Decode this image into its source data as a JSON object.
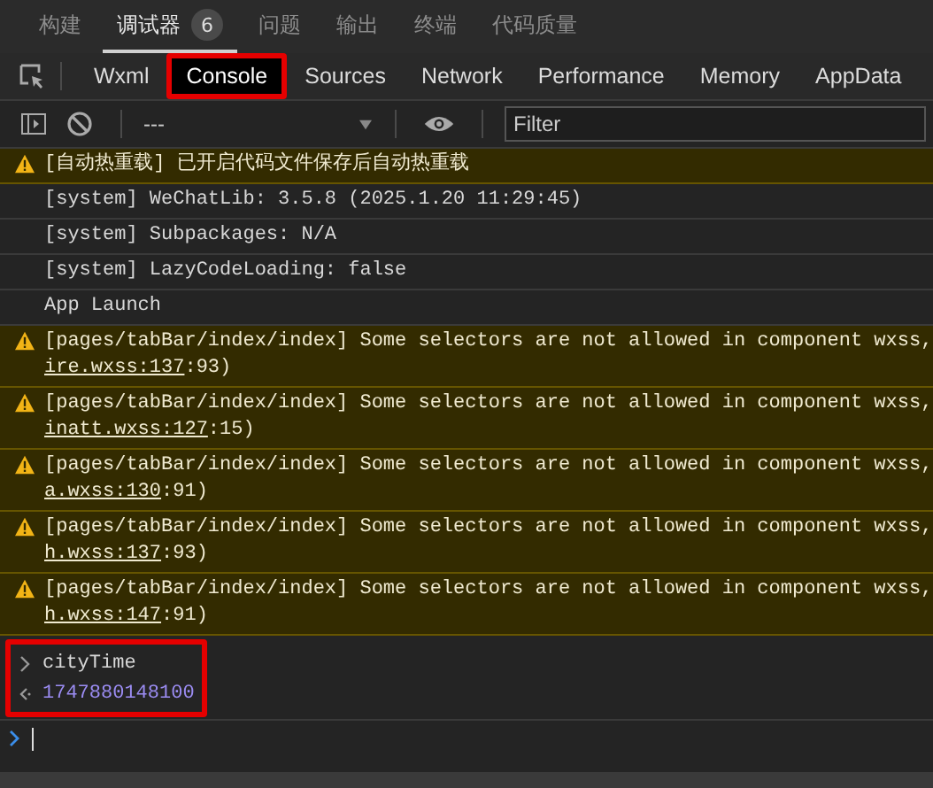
{
  "top_tabs": [
    {
      "label": "构建",
      "selected": false
    },
    {
      "label": "调试器",
      "selected": true,
      "badge": "6"
    },
    {
      "label": "问题",
      "selected": false
    },
    {
      "label": "输出",
      "selected": false
    },
    {
      "label": "终端",
      "selected": false
    },
    {
      "label": "代码质量",
      "selected": false
    }
  ],
  "devtools_tabs": [
    {
      "label": "Wxml",
      "selected": false,
      "highlighted": false
    },
    {
      "label": "Console",
      "selected": true,
      "highlighted": true
    },
    {
      "label": "Sources",
      "selected": false,
      "highlighted": false
    },
    {
      "label": "Network",
      "selected": false,
      "highlighted": false
    },
    {
      "label": "Performance",
      "selected": false,
      "highlighted": false
    },
    {
      "label": "Memory",
      "selected": false,
      "highlighted": false
    },
    {
      "label": "AppData",
      "selected": false,
      "highlighted": false
    }
  ],
  "toolbar": {
    "context": "---",
    "filter_placeholder": "Filter"
  },
  "console": {
    "entries": [
      {
        "kind": "warning",
        "text": "[自动热重载] 已开启代码文件保存后自动热重载"
      },
      {
        "kind": "log",
        "text": "[system] WeChatLib: 3.5.8 (2025.1.20 11:29:45)"
      },
      {
        "kind": "log",
        "text": "[system] Subpackages: N/A"
      },
      {
        "kind": "log",
        "text": "[system] LazyCodeLoading: false"
      },
      {
        "kind": "log",
        "text": "App Launch"
      },
      {
        "kind": "warning",
        "text": "[pages/tabBar/index/index] Some selectors are not allowed in component wxss,",
        "link": "ire.wxss:137",
        "tail": ":93)"
      },
      {
        "kind": "warning",
        "text": "[pages/tabBar/index/index] Some selectors are not allowed in component wxss,",
        "link": "inatt.wxss:127",
        "tail": ":15)"
      },
      {
        "kind": "warning",
        "text": "[pages/tabBar/index/index] Some selectors are not allowed in component wxss,",
        "link": "a.wxss:130",
        "tail": ":91)"
      },
      {
        "kind": "warning",
        "text": "[pages/tabBar/index/index] Some selectors are not allowed in component wxss,",
        "link": "h.wxss:137",
        "tail": ":93)"
      },
      {
        "kind": "warning",
        "text": "[pages/tabBar/index/index] Some selectors are not allowed in component wxss,",
        "link": "h.wxss:147",
        "tail": ":91)"
      }
    ],
    "evaluation": {
      "highlighted": true,
      "input": "cityTime",
      "result": "1747880148100"
    }
  }
}
